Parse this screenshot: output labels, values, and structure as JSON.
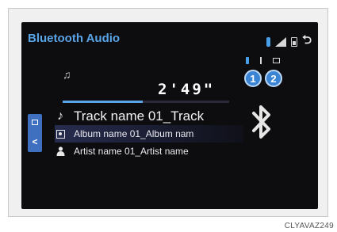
{
  "header": {
    "title": "Bluetooth Audio"
  },
  "devices": [
    {
      "label": "1"
    },
    {
      "label": "2"
    }
  ],
  "playback": {
    "elapsed_time": "2'49\"",
    "progress": 0.48
  },
  "track_info": {
    "track_name": "Track name 01_Track",
    "album_name": "Album name 01_Album nam",
    "artist_name": "Artist name 01_Artist name"
  },
  "colors": {
    "accent": "#5aa5e8",
    "device_button": "#3b84d4",
    "side_tab": "#3f6fbf"
  },
  "figure_code": "CLYAVAZ249"
}
